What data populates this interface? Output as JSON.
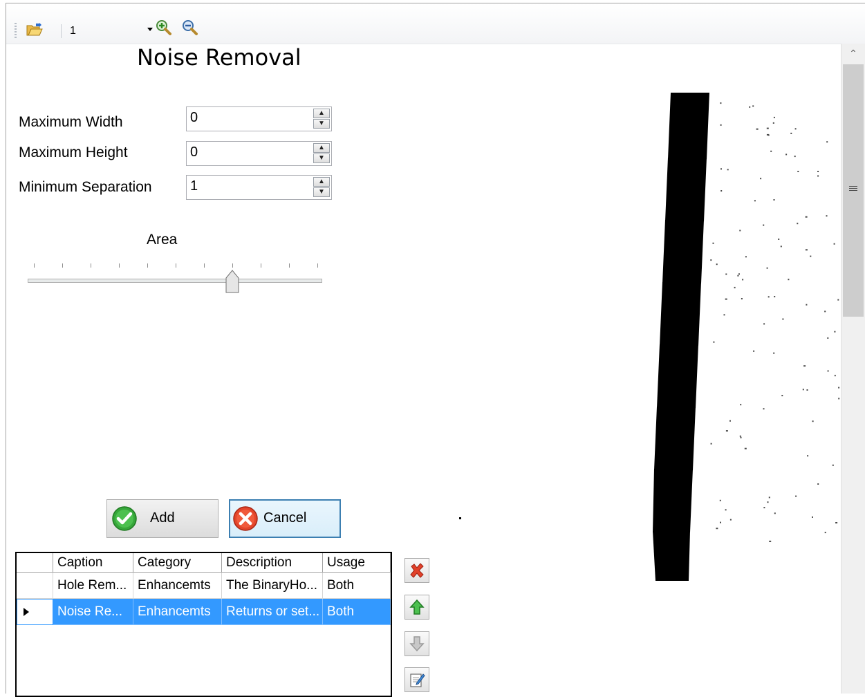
{
  "toolbar": {
    "open_icon": "folder-open-icon",
    "page_value": "1",
    "zoom_in_icon": "zoom-in-icon",
    "zoom_out_icon": "zoom-out-icon"
  },
  "panel": {
    "title": "Noise Removal",
    "fields": [
      {
        "label": "Maximum Width",
        "value": "0"
      },
      {
        "label": "Maximum Height",
        "value": "0"
      },
      {
        "label": "Minimum Separation",
        "value": "1"
      }
    ],
    "slider": {
      "label": "Area",
      "min": 0,
      "max": 10,
      "value": 7
    }
  },
  "buttons": {
    "add_label": "Add",
    "add_icon": "check-icon",
    "cancel_label": "Cancel",
    "cancel_icon": "x-circle-icon"
  },
  "grid": {
    "columns": [
      "Caption",
      "Category",
      "Description",
      "Usage"
    ],
    "rows": [
      {
        "caption": "Hole Rem...",
        "category": "Enhancemts",
        "description": "The BinaryHo...",
        "usage": "Both",
        "selected": false
      },
      {
        "caption": "Noise Re...",
        "category": "Enhancemts",
        "description": "Returns or set...",
        "usage": "Both",
        "selected": true
      }
    ]
  },
  "side_buttons": [
    "delete-icon",
    "move-up-icon",
    "move-down-icon",
    "edit-icon"
  ],
  "colors": {
    "selection": "#3399ff",
    "accent_border": "#3c7fb1"
  }
}
